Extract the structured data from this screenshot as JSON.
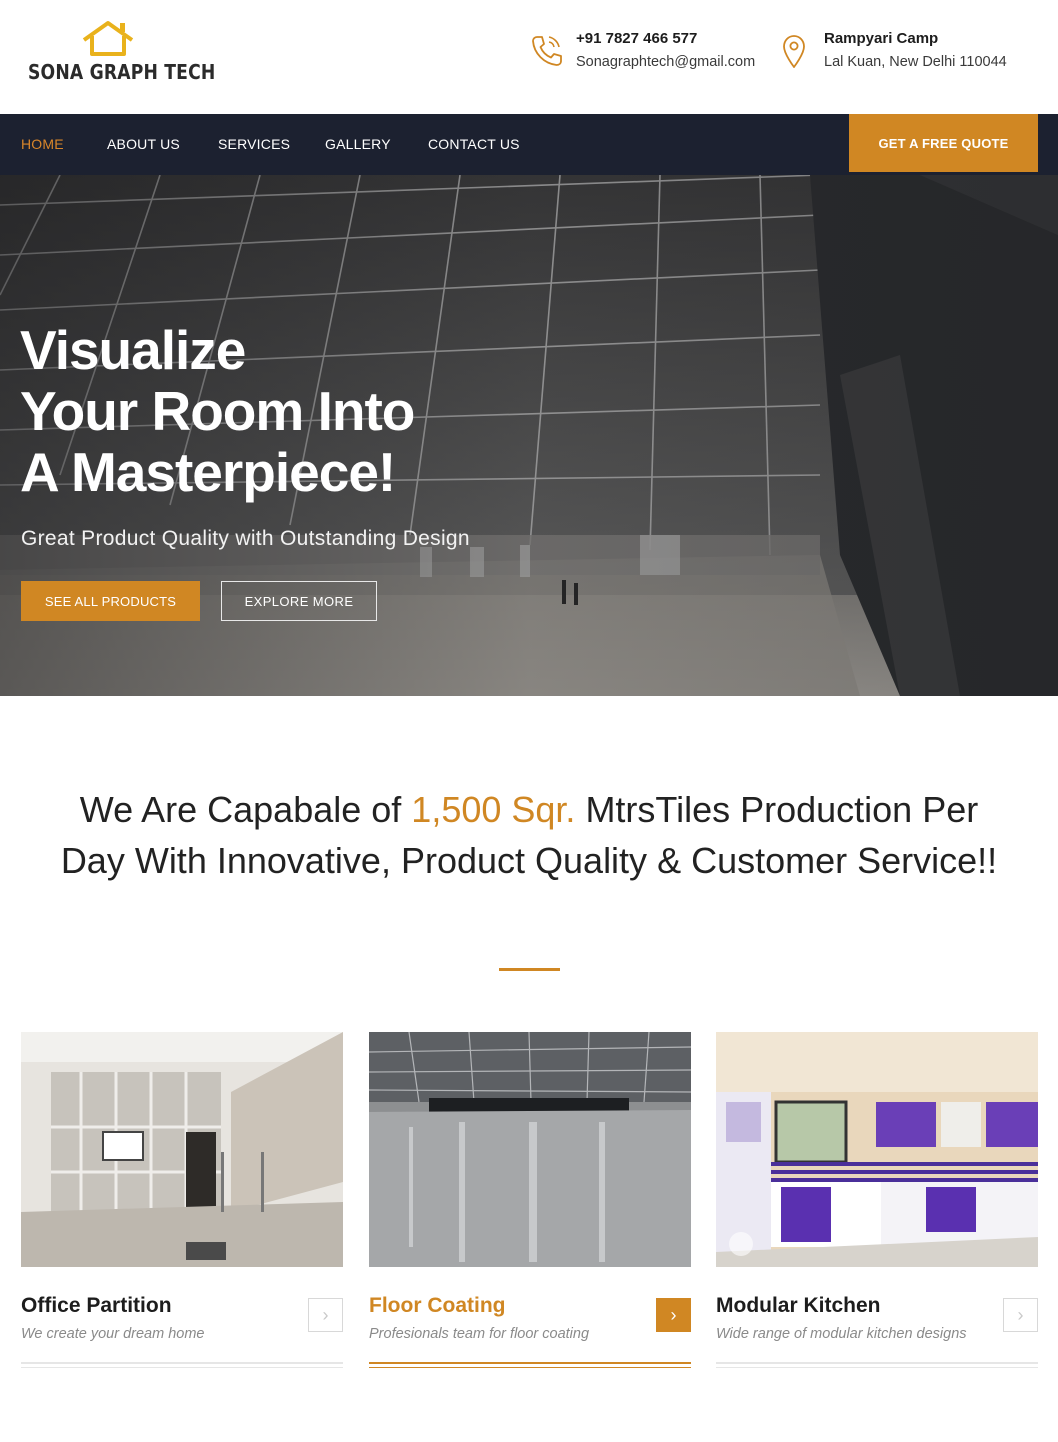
{
  "brand": {
    "name": "SONA GRAPH TECH",
    "icon": "house-outline-icon",
    "accent_color": "#d08723"
  },
  "contact": {
    "phone": "+91 7827 466 577",
    "email": "Sonagraphtech@gmail.com",
    "address_line1": "Rampyari Camp",
    "address_line2": "Lal Kuan, New Delhi 110044"
  },
  "nav": {
    "items": [
      {
        "label": "HOME",
        "active": true
      },
      {
        "label": "ABOUT US",
        "active": false
      },
      {
        "label": "SERVICES",
        "active": false
      },
      {
        "label": "GALLERY",
        "active": false
      },
      {
        "label": "CONTACT US",
        "active": false
      }
    ],
    "cta": "GET A FREE QUOTE",
    "bg_color": "#1c2130"
  },
  "hero": {
    "title_lines": [
      "Visualize",
      "Your Room Into",
      "A Masterpiece!"
    ],
    "subtitle": "Great Product Quality with Outstanding Design",
    "primary_button": "SEE ALL PRODUCTS",
    "secondary_button": "EXPLORE MORE"
  },
  "intro": {
    "part1": "We Are Capabale of ",
    "highlight": "1,500 Sqr.",
    "part2": " MtrsTiles Production Per Day With Innovative, Product Quality & Customer Service!!"
  },
  "cards": [
    {
      "title": "Office Partition",
      "desc": "We create your dream home",
      "active": false
    },
    {
      "title": "Floor Coating",
      "desc": "Profesionals team for floor coating",
      "active": true
    },
    {
      "title": "Modular Kitchen",
      "desc": "Wide range of modular kitchen designs",
      "active": false
    }
  ]
}
